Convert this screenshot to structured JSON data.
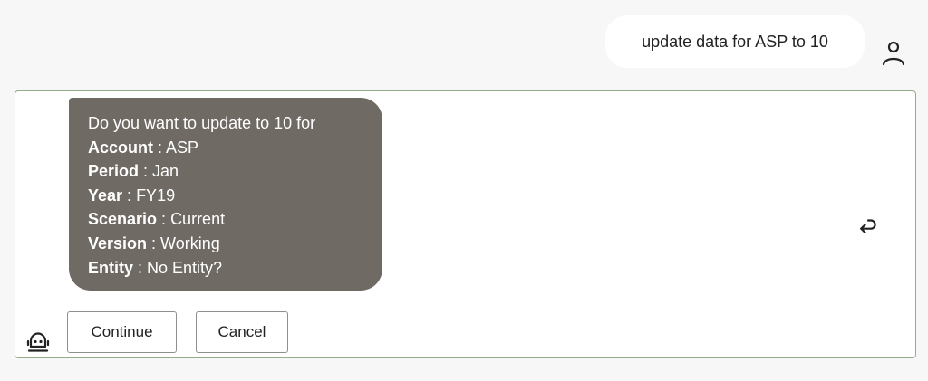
{
  "user_message": {
    "text": "update data for ASP to 10",
    "avatar_icon": "user-icon"
  },
  "bot_message": {
    "intro": "Do you want to update to 10 for",
    "fields": [
      {
        "label": "Account",
        "value": "ASP"
      },
      {
        "label": "Period",
        "value": "Jan"
      },
      {
        "label": "Year",
        "value": "FY19"
      },
      {
        "label": "Scenario",
        "value": "Current"
      },
      {
        "label": "Version",
        "value": "Working"
      },
      {
        "label": "Entity",
        "value": "No Entity?"
      }
    ],
    "separator": " : ",
    "bubble_color": "#6f6a64",
    "avatar_icon": "bot-icon",
    "reply_icon": "reply-icon"
  },
  "actions": {
    "continue_label": "Continue",
    "cancel_label": "Cancel"
  },
  "colors": {
    "background": "#f7f7f7",
    "panel_border": "#96ab8a",
    "bubble_text": "#ffffff"
  }
}
